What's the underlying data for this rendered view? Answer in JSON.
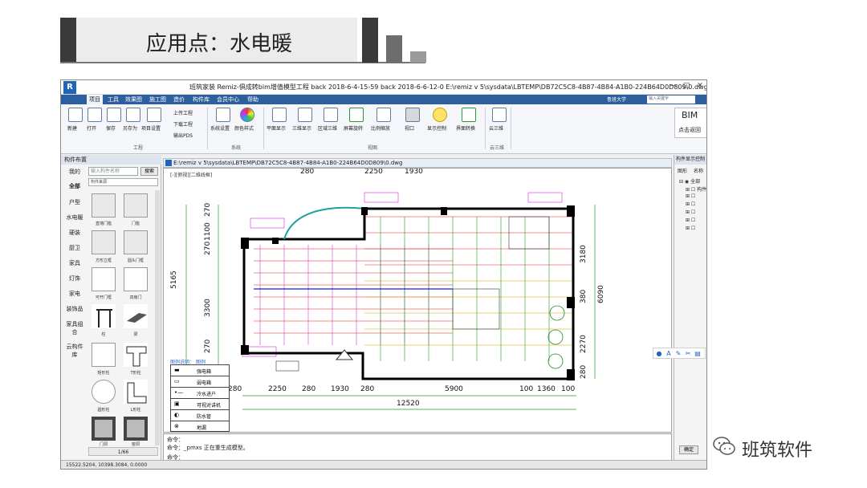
{
  "slide": {
    "title": "应用点：水电暖"
  },
  "app": {
    "title": "班筑家装 Remiz-俱成转bim增值模型工程 back 2018-6-4-15-59 back 2018-6-6-12-0     E:\\remiz v 5\\sysdata\\LBTEMP\\DB72C5C8-4B87-4B84-A1B0-224B64D0D809\\0.dwg",
    "logo": "R",
    "win_controls": [
      "—",
      "□",
      "✕"
    ],
    "menu": [
      "项目",
      "工具",
      "效果图",
      "施工图",
      "造价",
      "构件库",
      "会员中心",
      "帮助"
    ],
    "menu_right": "鲁班大学",
    "search_placeholder": "输入关键字",
    "ribbon": {
      "project": [
        "新建",
        "打开",
        "保存",
        "另存为",
        "项目设置"
      ],
      "project_small": [
        "上传工程",
        "下载工程",
        "输出PDS"
      ],
      "system": [
        "系统设置",
        "颜色样式"
      ],
      "view": [
        "平面显示",
        "三维显示",
        "区域三维",
        "屏幕旋转",
        "比例缩放",
        "视口",
        "显示控制",
        "界面转换"
      ],
      "cloud": [
        "云三维"
      ],
      "groups": [
        "工程",
        "系统",
        "视图",
        "云三维"
      ]
    },
    "bim": {
      "title": "BIM",
      "subtitle": "点击返回"
    }
  },
  "left_panel": {
    "header": "构件布置",
    "search_label": "我的",
    "search_placeholder": "输入构件名称",
    "search_button": "搜索",
    "filter_value": "构件来源",
    "categories": [
      "全部",
      "户型",
      "水电暖",
      "硬装",
      "厨卫",
      "家具",
      "灯饰",
      "家电",
      "装饰品",
      "家具组合",
      "云构件库"
    ],
    "tiles": [
      "直墙门槛",
      "门槛",
      "方形立框",
      "圆头门框",
      "可开门框",
      "双扇门",
      "柱",
      "梁",
      "矩形柱",
      "T形柱",
      "圆形柱",
      "L形柱",
      "门洞",
      "窗洞"
    ],
    "pager": "1/66"
  },
  "drawing": {
    "tab_title": "E:\\remiz v 5\\sysdata\\LBTEMP\\DB72C5C8-4B87-4B84-A1B0-224B64D0D809\\0.dwg",
    "view_label": "[-][俯视][二维线框]",
    "dims_top_left": [
      "280",
      "2250",
      "280",
      "1930",
      "280"
    ],
    "dims_top_right": [
      "5900",
      "100",
      "1360",
      "100"
    ],
    "dim_total": "12520",
    "dims_left": [
      "270",
      "1100",
      "270",
      "5165",
      "3300",
      "270"
    ],
    "dims_right": [
      "3180",
      "380",
      "6090",
      "2270",
      "280"
    ],
    "legend_title": "图例说明：  图例",
    "legend": [
      {
        "symbol": "▬",
        "label": "强电箱"
      },
      {
        "symbol": "▭",
        "label": "弱电箱"
      },
      {
        "symbol": "•—",
        "label": "冷水进户"
      },
      {
        "symbol": "▣",
        "label": "可视对讲机"
      },
      {
        "symbol": "◐",
        "label": "防水管"
      },
      {
        "symbol": "⊗",
        "label": "地漏"
      }
    ]
  },
  "command": {
    "lines": [
      "命令：",
      "命令：_pmxs 正在重生成模型。",
      "命令："
    ]
  },
  "status": {
    "coords": "15522.5204, 10398.3084, 0.0000"
  },
  "right_panel": {
    "header": "构件显示控制",
    "tabs": [
      "图形",
      "名称"
    ],
    "tree_root": "全部",
    "tree_child": "构件",
    "confirm": "确定"
  },
  "float_toolbar": [
    "●",
    "A",
    "✎",
    "✂",
    "▤"
  ],
  "watermark": {
    "text": "班筑软件"
  },
  "colors": {
    "menu": "#2d5f9e",
    "wall": "#000000",
    "cad_red": "#e02020",
    "cad_magenta": "#e020e0",
    "cad_green": "#20a020"
  }
}
